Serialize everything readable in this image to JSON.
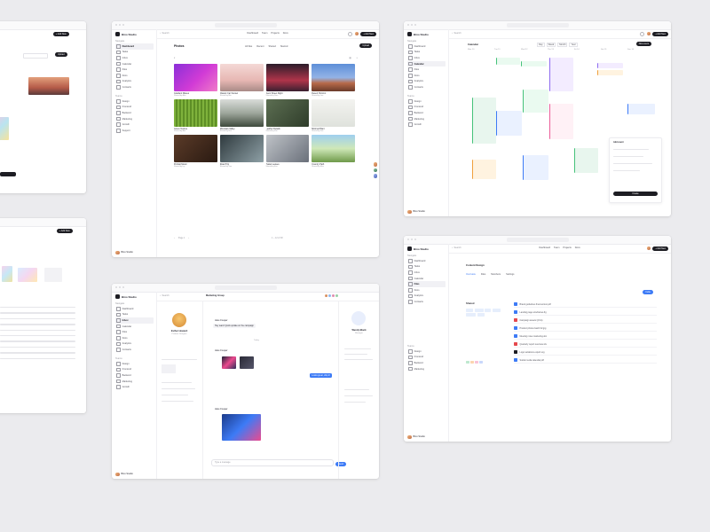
{
  "brand": {
    "name": "Bino Studio"
  },
  "nav": {
    "section_main": "Navigate",
    "items": [
      "Dashboard",
      "Tasks",
      "Inbox",
      "Calendar",
      "Files",
      "Docs",
      "Analytics",
      "Contacts"
    ],
    "section_team": "Teams",
    "team_items": [
      "Design",
      "Frontend",
      "Backend",
      "Marketing",
      "Growth",
      "Support",
      "Sales"
    ]
  },
  "topbar": {
    "search": "Search",
    "links": [
      "Dashboard",
      "Team",
      "Projects",
      "Docs"
    ],
    "new_button": "+ Add New"
  },
  "photos": {
    "title": "Photos",
    "tabs": [
      "All files",
      "Recent",
      "Shared",
      "Starred"
    ],
    "upload": "Upload",
    "items": [
      {
        "name": "Gradient Waves",
        "meta": "Shared by Alex"
      },
      {
        "name": "Classic Car Sunset",
        "meta": "Shared by Mia"
      },
      {
        "name": "Neon Street Night",
        "meta": "Shared by Sam"
      },
      {
        "name": "Desert Horizon",
        "meta": "Shared by Leo"
      },
      {
        "name": "Green Texture",
        "meta": "Shared by Ann"
      },
      {
        "name": "Mountain Valley",
        "meta": "Shared by Ben"
      },
      {
        "name": "Leather Details",
        "meta": "Shared by Kim"
      },
      {
        "name": "Minimal Plant",
        "meta": "Shared by Zoe"
      },
      {
        "name": "Portrait Mood",
        "meta": "Shared by Ivy"
      },
      {
        "name": "Road Trip",
        "meta": "Shared by Tom"
      },
      {
        "name": "Pastel Leaves",
        "meta": "Shared by Eva"
      },
      {
        "name": "Country Path",
        "meta": "Shared by Max"
      }
    ],
    "footer": "1 – 12 of 48",
    "pager": "Page 1"
  },
  "chat": {
    "channel": "Marketing Group",
    "profile_name": "Esther Howard",
    "profile_role": "Product Designer",
    "messages": [
      {
        "author": "Jane Cooper",
        "text": "Hey team! Quick update on the campaign"
      },
      {
        "author": "Jane Cooper",
        "text": "Sharing the latest assets"
      },
      {
        "author": "Ralph Edwards",
        "text": "Looks great, ship it!"
      },
      {
        "author": "Jane Cooper",
        "text": "Final cover art is ready"
      }
    ],
    "composer": "Type a message",
    "send": "Send",
    "right_name": "Wendy Black",
    "right_role": "Manager",
    "today": "Today"
  },
  "calendar": {
    "title": "Calendar",
    "views": [
      "Day",
      "Week",
      "Month",
      "Year"
    ],
    "days": [
      "Mon 10",
      "Tue 11",
      "Wed 12",
      "Thu 13",
      "Fri 14",
      "Sat 15",
      "Sun 16"
    ],
    "new_event": "New event",
    "panel_title": "Add event",
    "panel_button": "Create"
  },
  "files": {
    "project": "Content Design",
    "tabs": [
      "Overview",
      "Files",
      "Members",
      "Settings"
    ],
    "invite": "Invite",
    "sidebar_title": "Shared",
    "rows": [
      "Brand guidelines final version.pdf",
      "Landing page wireframes.fig",
      "Campaign assets Q3.zip",
      "Product photos batch 02.jpg",
      "Meeting notes marketing.doc",
      "Quarterly report overview.xls",
      "Logo variations export.svg",
      "Social media calendar.pdf"
    ]
  },
  "colors": {
    "accent": "#3d7bf6",
    "dark": "#1d1d23",
    "bg": "#ebebee"
  }
}
